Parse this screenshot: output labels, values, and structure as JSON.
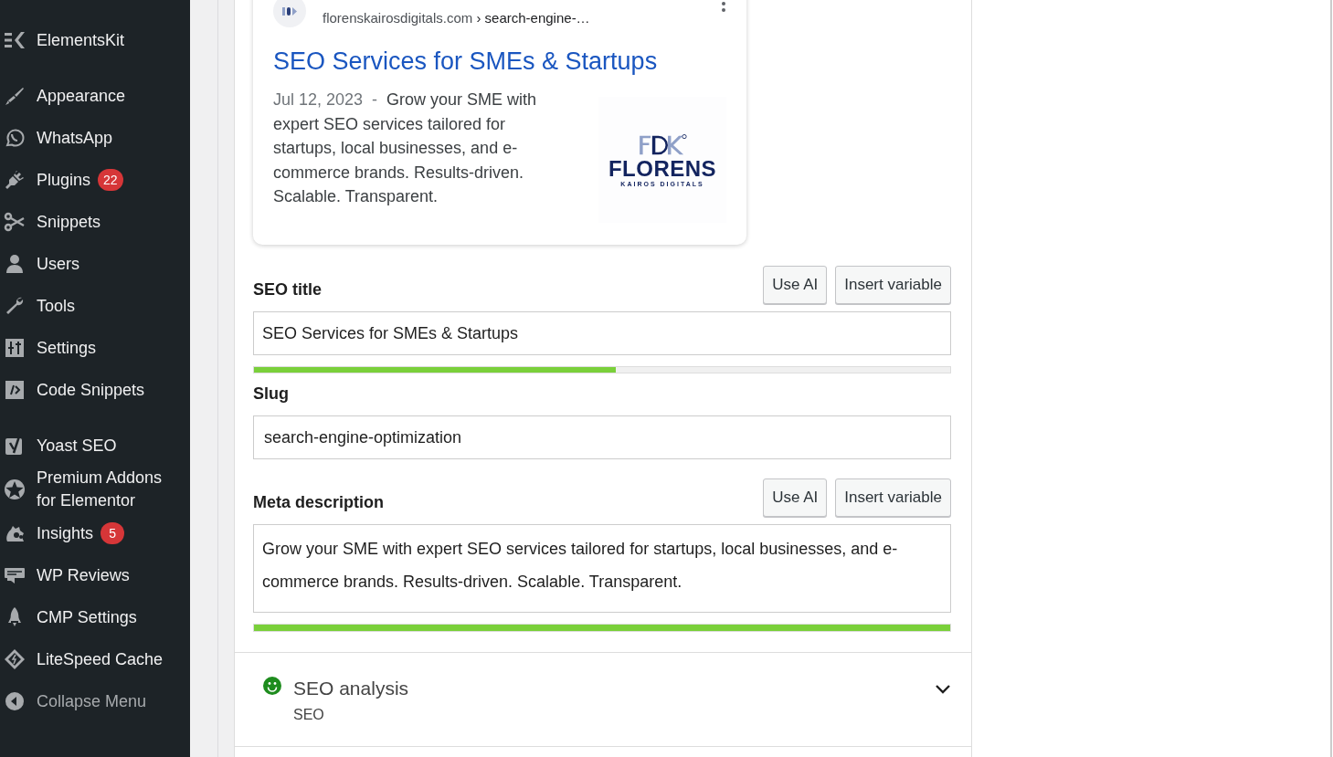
{
  "sidebar": {
    "groups": [
      [
        {
          "label": "ElementsKit"
        }
      ],
      [
        {
          "label": "Appearance"
        },
        {
          "label": "WhatsApp"
        },
        {
          "label": "Plugins",
          "badge": "22"
        },
        {
          "label": "Snippets"
        },
        {
          "label": "Users"
        },
        {
          "label": "Tools"
        },
        {
          "label": "Settings"
        },
        {
          "label": "Code Snippets"
        }
      ],
      [
        {
          "label": "Yoast SEO"
        },
        {
          "label": "Premium Addons for Elementor"
        },
        {
          "label": "Insights",
          "badge": "5"
        },
        {
          "label": "WP Reviews"
        },
        {
          "label": "CMP Settings"
        },
        {
          "label": "LiteSpeed Cache"
        }
      ]
    ],
    "collapse": {
      "label": "Collapse Menu"
    }
  },
  "preview": {
    "url": "florenskairosdigitals.com",
    "breadcrumb": "› search-engine-…",
    "title": "SEO Services for SMEs & Startups",
    "date": "Jul 12, 2023",
    "separator": "-",
    "description": "Grow your SME with expert SEO services tailored for startups, local businesses, and e-commerce brands. Results-driven. Scalable. Transparent.",
    "logo": {
      "name": "FLORENS",
      "tagline": "KAIROS DIGITALS"
    }
  },
  "seo_title": {
    "label": "SEO title",
    "buttons": [
      "Use AI",
      "Insert variable"
    ],
    "value": "SEO Services for SMEs & Startups",
    "level": 0.52
  },
  "slug": {
    "label": "Slug",
    "value": "search-engine-optimization"
  },
  "meta_description": {
    "label": "Meta description",
    "buttons": [
      "Use AI",
      "Insert variable"
    ],
    "value": "Grow your SME with expert SEO services tailored for startups, local businesses, and e-commerce brands. Results-driven. Scalable. Transparent.",
    "level": 1
  },
  "analysis": {
    "title": "SEO analysis",
    "subtitle": "SEO",
    "expanded": false
  }
}
